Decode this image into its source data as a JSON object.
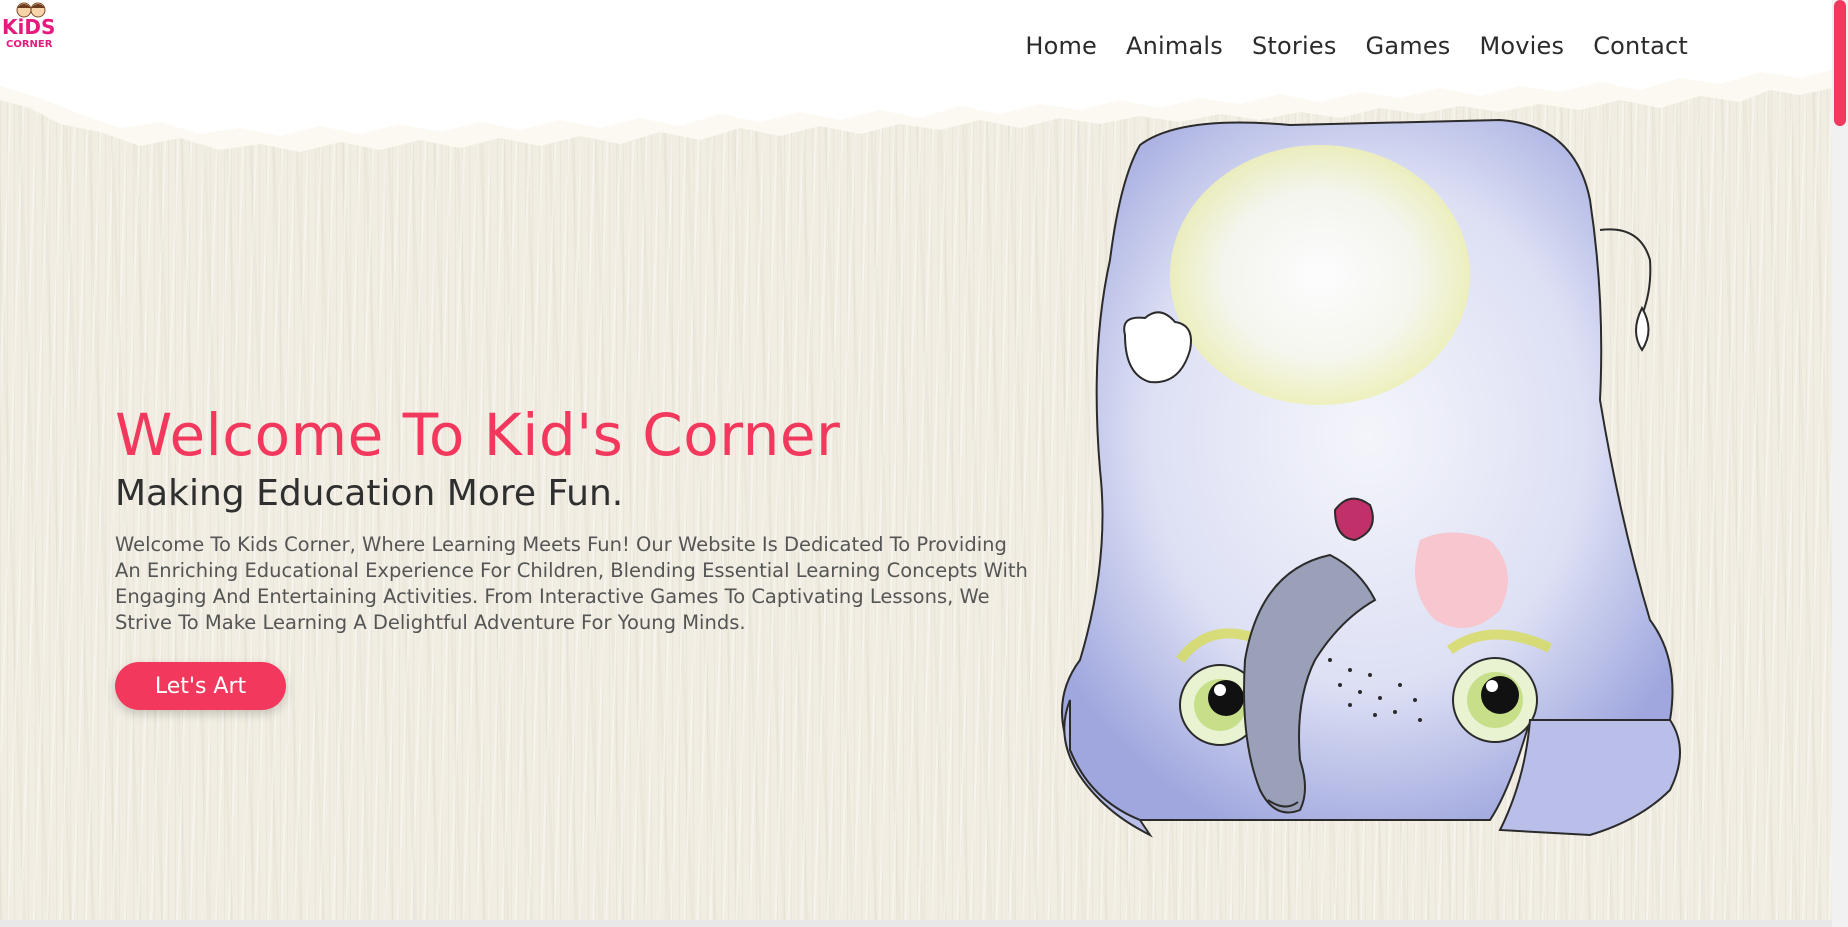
{
  "logo": {
    "line1": "KiDS",
    "line2": "CORNER"
  },
  "nav": {
    "items": [
      {
        "label": "Home"
      },
      {
        "label": "Animals"
      },
      {
        "label": "Stories"
      },
      {
        "label": "Games"
      },
      {
        "label": "Movies"
      },
      {
        "label": "Contact"
      }
    ]
  },
  "hero": {
    "title": "Welcome To Kid's Corner",
    "subtitle": "Making Education More Fun.",
    "body": "Welcome To Kids Corner, Where Learning Meets Fun! Our Website Is Dedicated To Providing An Enriching Educational Experience For Children, Blending Essential Learning Concepts With Engaging And Entertaining Activities. From Interactive Games To Captivating Lessons, We Strive To Make Learning A Delightful Adventure For Young Minds.",
    "cta_label": "Let's Art"
  },
  "colors": {
    "accent": "#f2395d",
    "paper": "#f1ede2",
    "elephant_blue": "#c8cdf0",
    "text_dark": "#2b2b2b"
  }
}
